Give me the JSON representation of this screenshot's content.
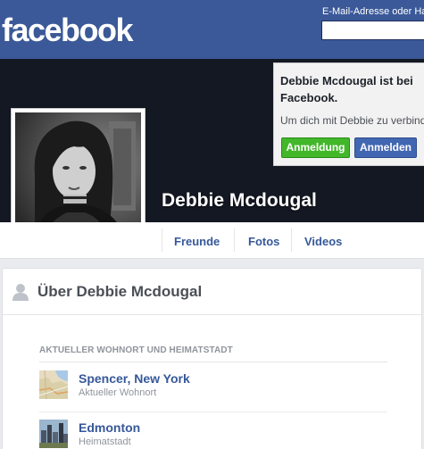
{
  "header": {
    "logo": "facebook",
    "email_label": "E-Mail-Adresse oder Handynummer",
    "email_value": ""
  },
  "profile": {
    "name": "Debbie Mcdougal"
  },
  "popup": {
    "title": "Debbie Mcdougal ist bei Facebook.",
    "text": "Um dich mit Debbie zu verbinden, registriere dich noch heute.",
    "signup_label": "Anmeldung",
    "login_label": "Anmelden"
  },
  "tabs": [
    {
      "label": "Freunde"
    },
    {
      "label": "Fotos"
    },
    {
      "label": "Videos"
    }
  ],
  "about": {
    "title": "Über Debbie Mcdougal",
    "section_label": "AKTUELLER WOHNORT UND HEIMATSTADT",
    "places": [
      {
        "name": "Spencer, New York",
        "sub": "Aktueller Wohnort",
        "icon": "map-thumbnail"
      },
      {
        "name": "Edmonton",
        "sub": "Heimatstadt",
        "icon": "city-thumbnail"
      }
    ]
  },
  "colors": {
    "brand_blue": "#3b5998",
    "link_blue": "#365899",
    "signup_green": "#42b72a",
    "login_blue": "#4267b2"
  }
}
